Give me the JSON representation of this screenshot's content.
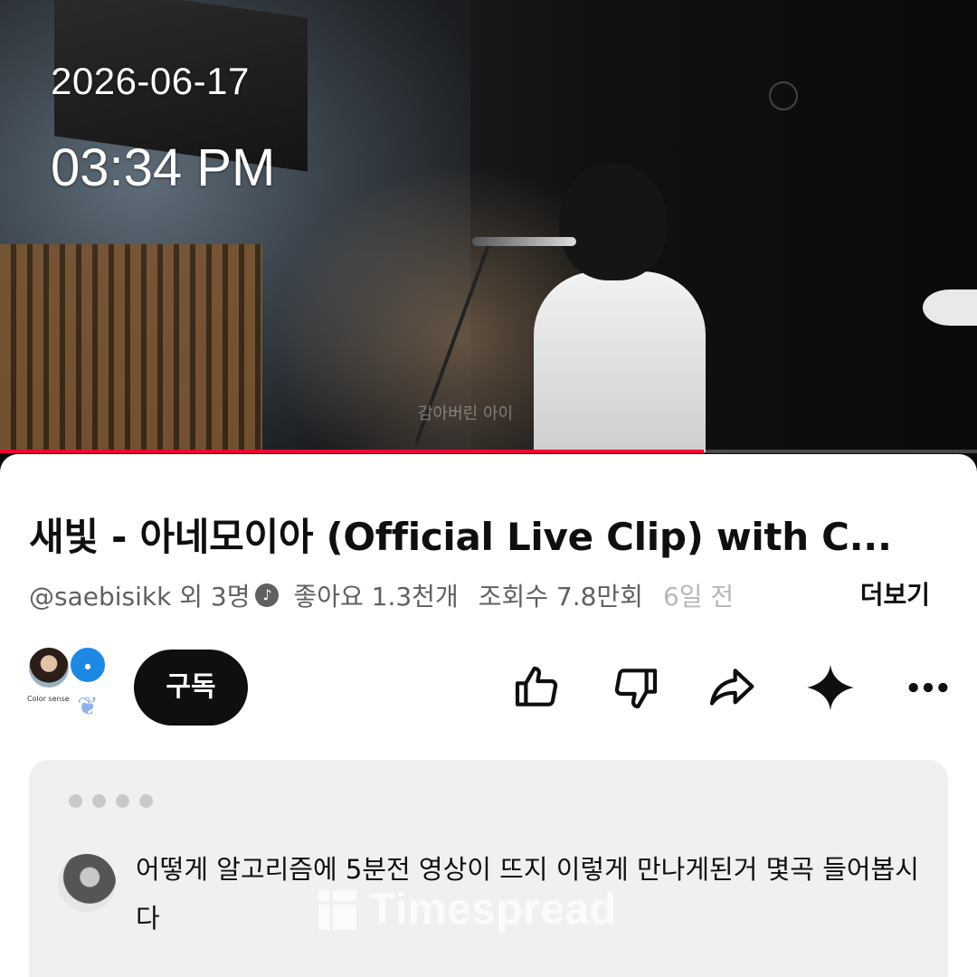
{
  "overlay": {
    "date": "2026-06-17",
    "time": "03:34 PM"
  },
  "video": {
    "caption": "감아버린 아이",
    "progress": 0.72
  },
  "details": {
    "title": "새빛 - 아네모이아 (Official Live Clip) with C...",
    "channel": "@saebisikk 외 3명",
    "likes": "좋아요 1.3천개",
    "views": "조회수 7.8만회",
    "age": "6일 전",
    "more_label": "더보기"
  },
  "actions": {
    "subscribe_label": "구독",
    "avatar_label": "Color sense",
    "partner_badge": "blue record",
    "icons": [
      "like-icon",
      "dislike-icon",
      "share-icon",
      "sparkle-icon",
      "more-icon"
    ]
  },
  "comments": {
    "text": "어떻게 알고리즘에 5분전 영상이 뜨지 이렇게 만나게된거 몇곡 들어봅시다"
  },
  "watermark": {
    "text": "Timespread"
  },
  "colors": {
    "accent": "#ff0033",
    "text": "#0f0f0f",
    "muted": "#606060",
    "card": "#f0f0f0"
  }
}
